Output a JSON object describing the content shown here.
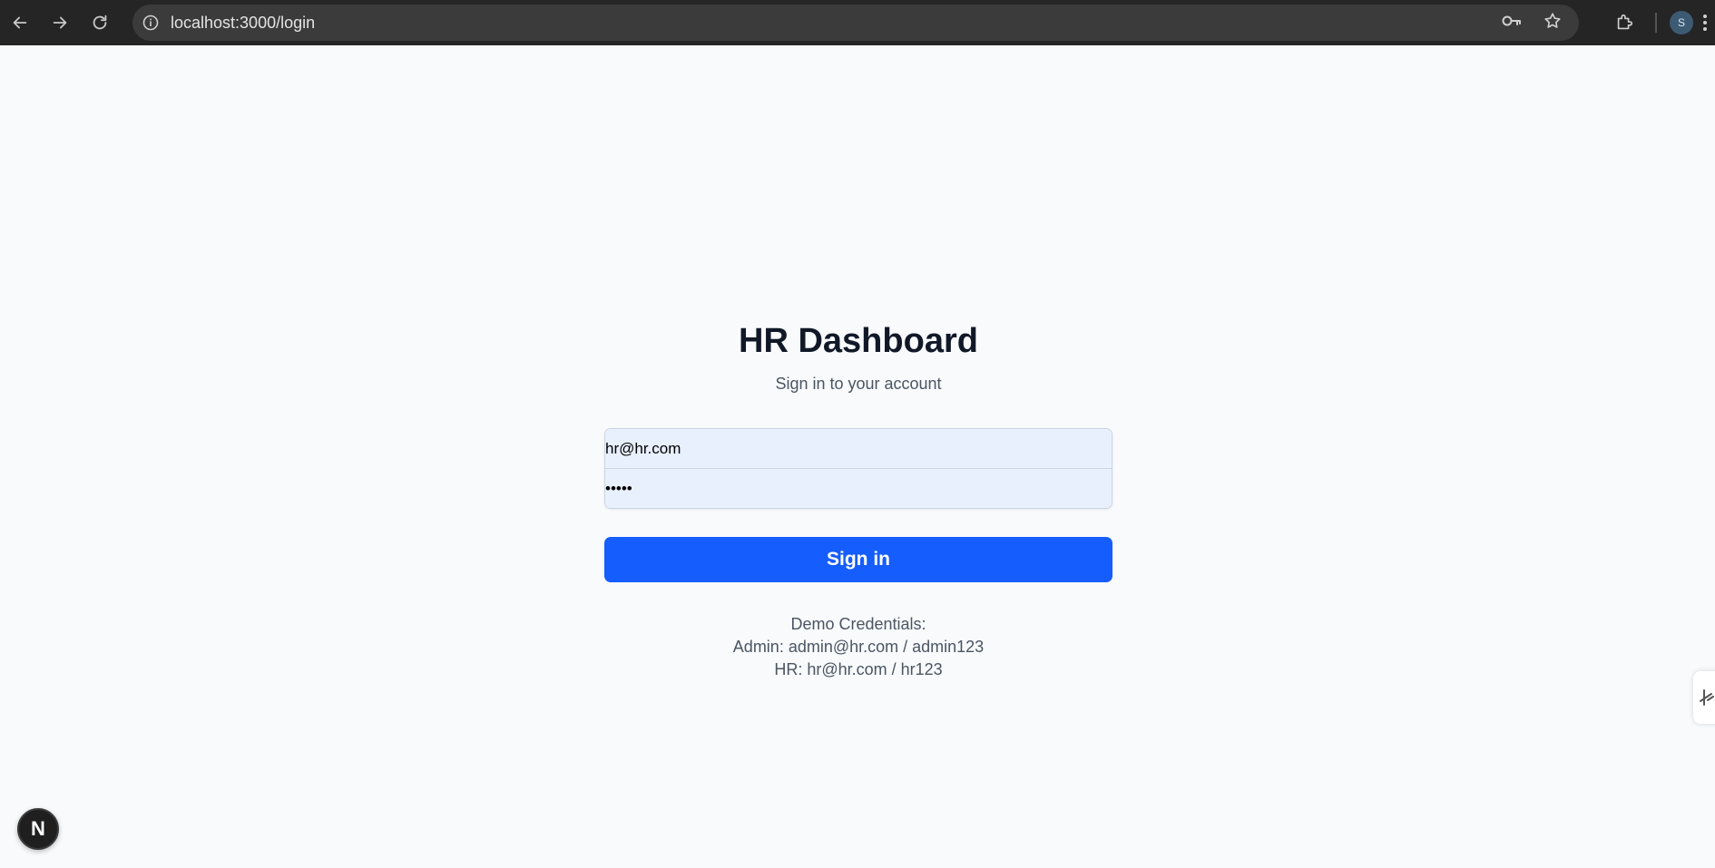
{
  "browser": {
    "url": "localhost:3000/login",
    "profile_initial": "S"
  },
  "login": {
    "title": "HR Dashboard",
    "subtitle": "Sign in to your account",
    "email_value": "hr@hr.com",
    "password_value": "hr123",
    "signin_label": "Sign in",
    "demo_heading": "Demo Credentials:",
    "demo_admin": "Admin: admin@hr.com / admin123",
    "demo_hr": "HR: hr@hr.com / hr123"
  },
  "devtools": {
    "badge_letter": "N"
  },
  "colors": {
    "primary_button": "#155dfc",
    "page_background": "#f8fafc",
    "autofill_background": "#e8f0fe"
  }
}
